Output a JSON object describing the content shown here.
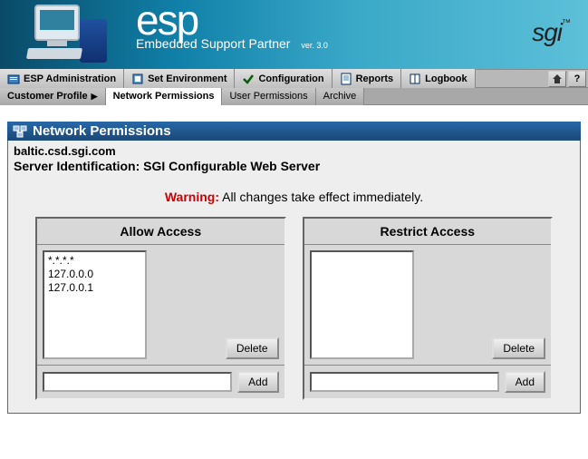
{
  "header": {
    "product_name": "esp",
    "product_subtitle": "Embedded Support Partner",
    "version_label": "ver. 3.0",
    "vendor": "sgi"
  },
  "nav_primary": {
    "items": [
      {
        "label": "ESP Administration"
      },
      {
        "label": "Set Environment"
      },
      {
        "label": "Configuration"
      },
      {
        "label": "Reports"
      },
      {
        "label": "Logbook"
      }
    ],
    "home_icon": "home",
    "help_icon": "?"
  },
  "nav_secondary": {
    "items": [
      {
        "label": "Customer Profile",
        "active": false
      },
      {
        "label": "Network Permissions",
        "active": true
      },
      {
        "label": "User Permissions",
        "active": false
      },
      {
        "label": "Archive",
        "active": false
      }
    ]
  },
  "panel": {
    "title": "Network Permissions",
    "hostname": "baltic.csd.sgi.com",
    "server_id_label": "Server Identification:",
    "server_id_value": "SGI Configurable Web Server",
    "warning_label": "Warning:",
    "warning_text": "All changes take effect immediately."
  },
  "allow": {
    "title": "Allow Access",
    "items": [
      "*.*.*.*",
      "127.0.0.0",
      "127.0.0.1"
    ],
    "delete_label": "Delete",
    "add_label": "Add",
    "input_value": ""
  },
  "restrict": {
    "title": "Restrict Access",
    "items": [],
    "delete_label": "Delete",
    "add_label": "Add",
    "input_value": ""
  }
}
